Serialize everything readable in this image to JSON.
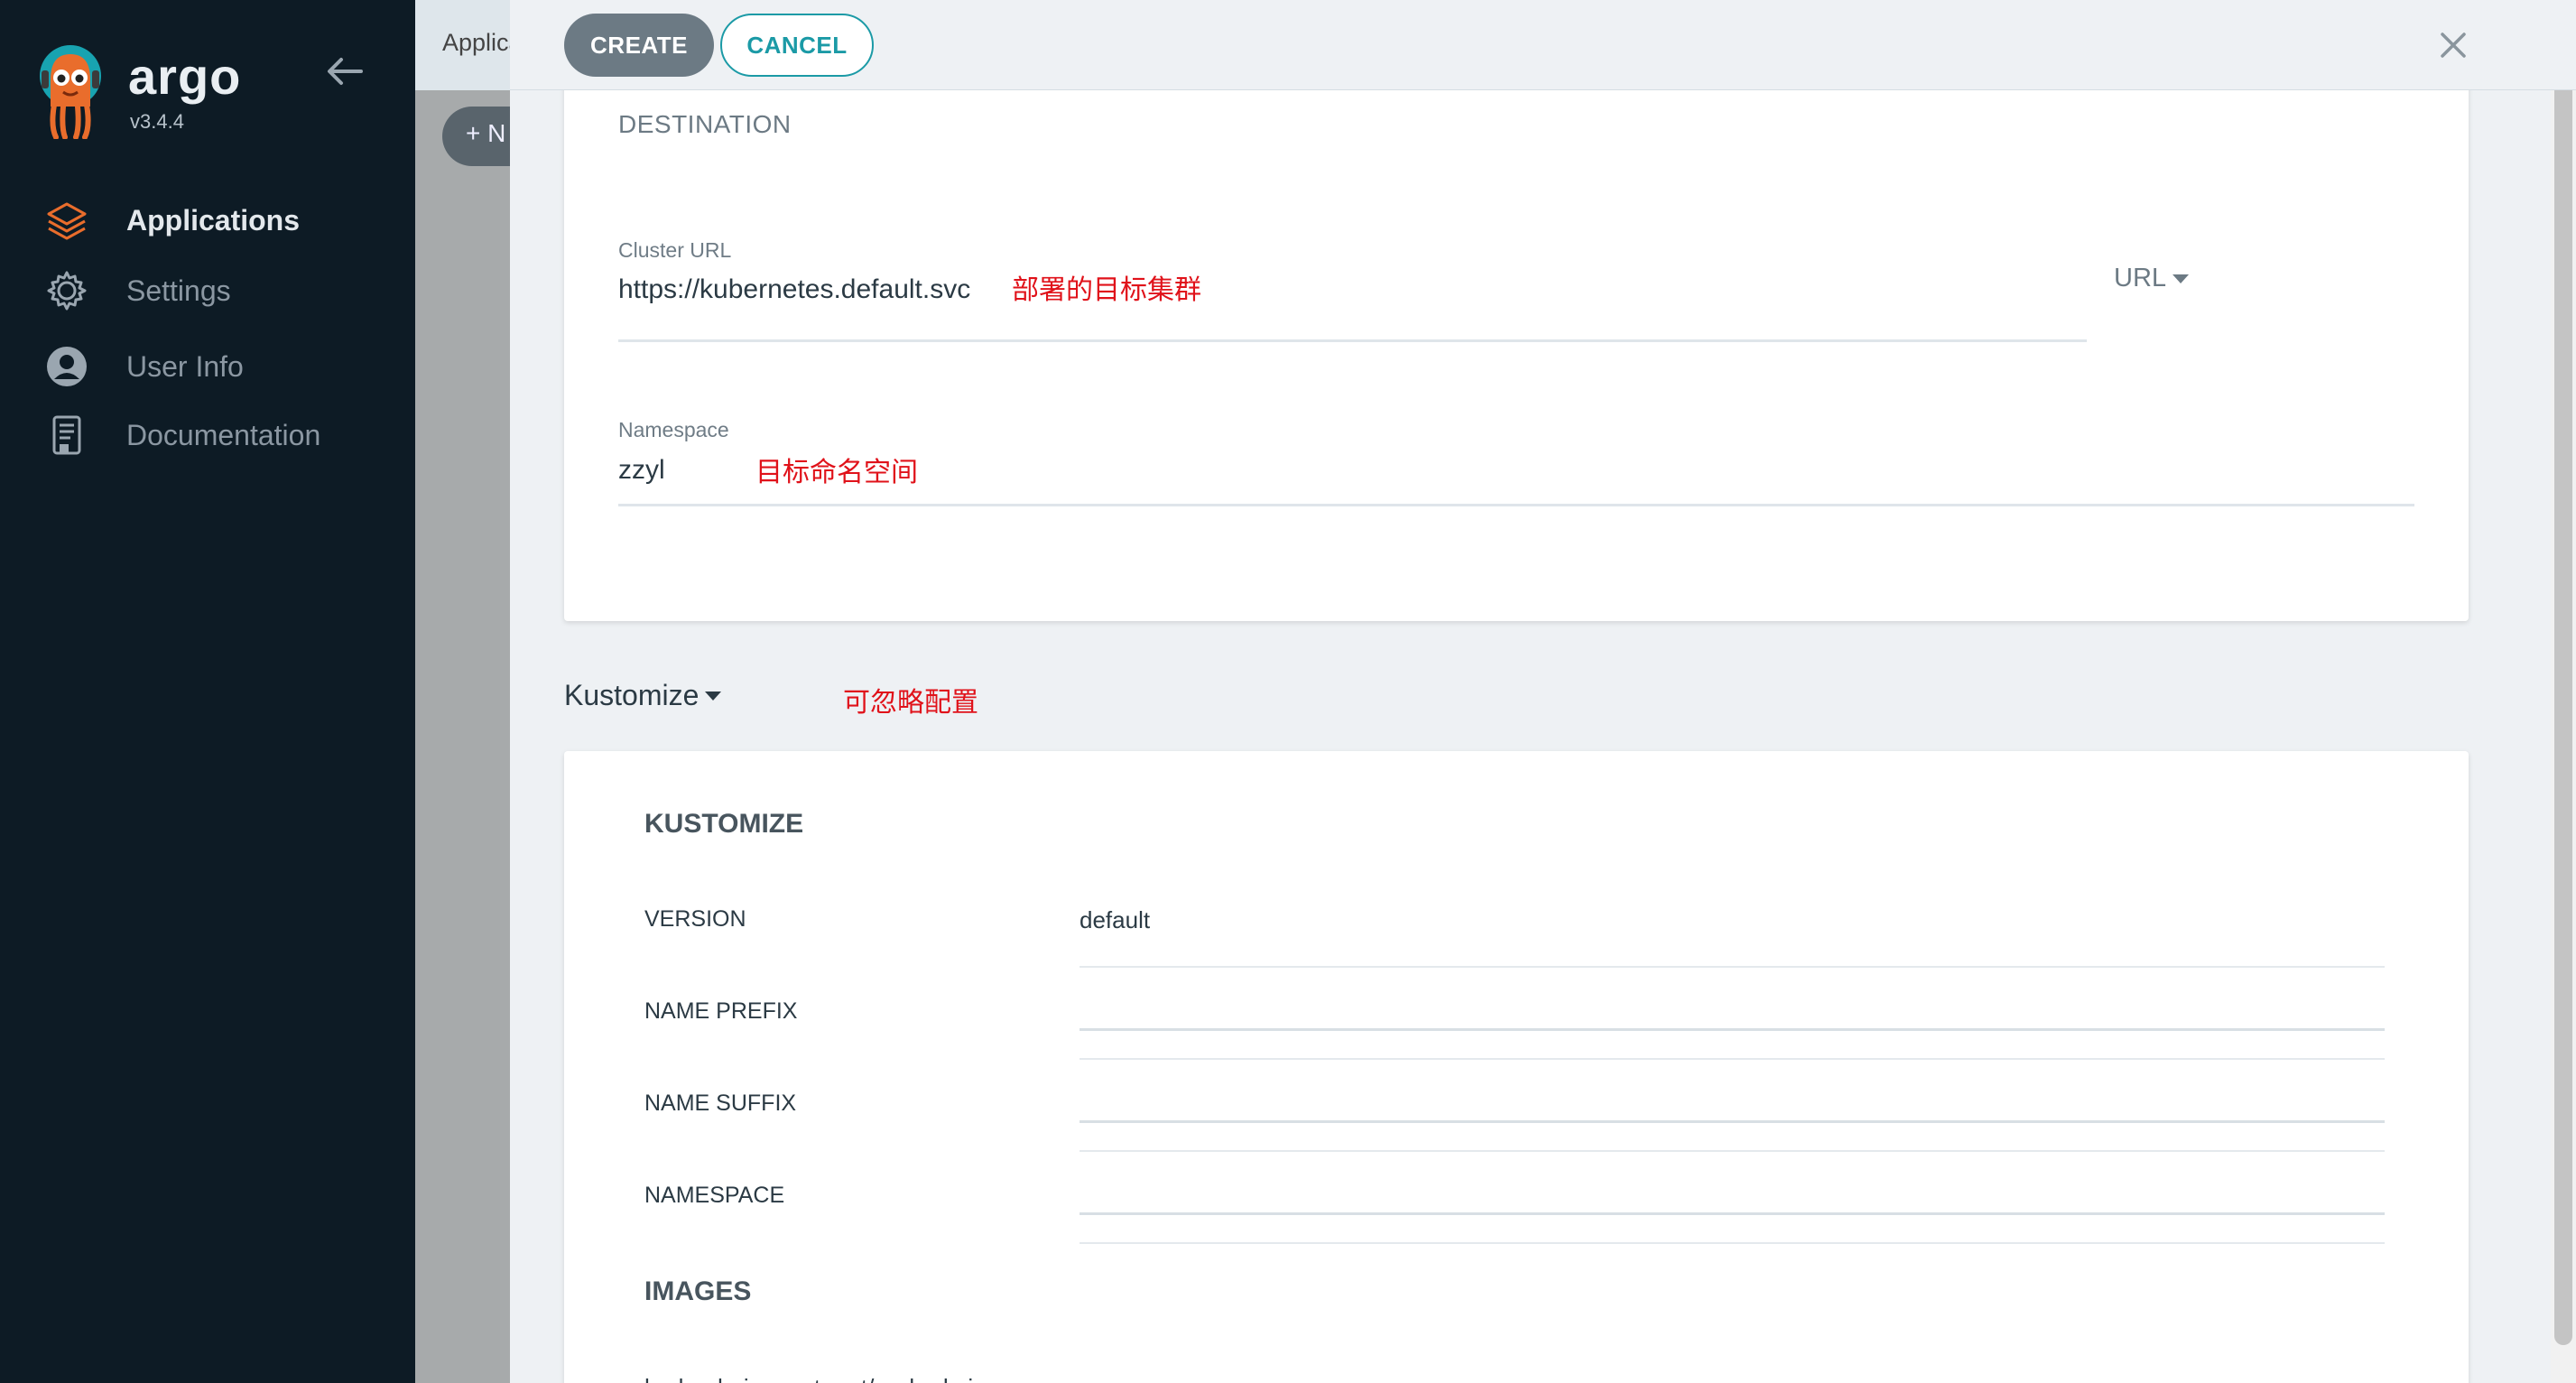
{
  "sidebar": {
    "brand": "argo",
    "version": "v3.4.4",
    "items": [
      {
        "label": "Applications",
        "icon": "layers-icon",
        "active": true
      },
      {
        "label": "Settings",
        "icon": "gear-icon",
        "active": false
      },
      {
        "label": "User Info",
        "icon": "user-circle-icon",
        "active": false
      },
      {
        "label": "Documentation",
        "icon": "document-icon",
        "active": false
      }
    ]
  },
  "background": {
    "title": "Applica",
    "new_button": "+ N"
  },
  "panel": {
    "create_label": "CREATE",
    "cancel_label": "CANCEL",
    "destination": {
      "heading": "DESTINATION",
      "cluster_url": {
        "label": "Cluster URL",
        "value": "https://kubernetes.default.svc",
        "annotation": "部署的目标集群",
        "mode_toggle": "URL"
      },
      "namespace": {
        "label": "Namespace",
        "value": "zzyl",
        "annotation": "目标命名空间"
      }
    },
    "kustomize": {
      "toggle": "Kustomize",
      "annotation": "可忽略配置",
      "title": "KUSTOMIZE",
      "rows": [
        {
          "label": "VERSION",
          "value": "default"
        },
        {
          "label": "NAME PREFIX",
          "value": ""
        },
        {
          "label": "NAME SUFFIX",
          "value": ""
        },
        {
          "label": "NAMESPACE",
          "value": ""
        }
      ],
      "images_title": "IMAGES",
      "images_partial": "harbor.heima.net:port/zzyl-admin..."
    }
  },
  "colors": {
    "sidebar_bg": "#0d1b25",
    "accent_teal": "#1b9aa6",
    "annotation_red": "#e0121a",
    "create_button": "#6c7a84",
    "logo_orange": "#e96d2c"
  }
}
